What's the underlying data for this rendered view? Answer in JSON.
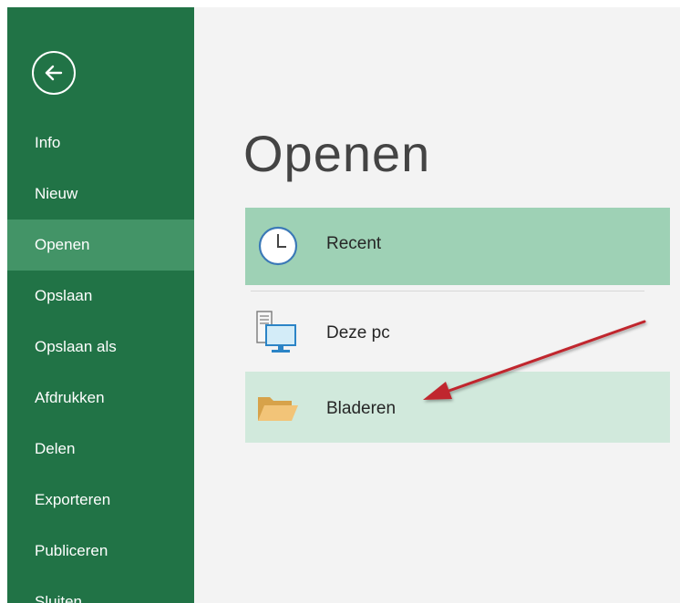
{
  "window": {
    "back_icon": "arrow-left-circle-icon"
  },
  "sidebar": {
    "items": [
      {
        "label": "Info",
        "active": false
      },
      {
        "label": "Nieuw",
        "active": false
      },
      {
        "label": "Openen",
        "active": true
      },
      {
        "label": "Opslaan",
        "active": false
      },
      {
        "label": "Opslaan als",
        "active": false
      },
      {
        "label": "Afdrukken",
        "active": false
      },
      {
        "label": "Delen",
        "active": false
      },
      {
        "label": "Exporteren",
        "active": false
      },
      {
        "label": "Publiceren",
        "active": false
      },
      {
        "label": "Sluiten",
        "active": false
      }
    ]
  },
  "main": {
    "title": "Openen",
    "locations": [
      {
        "label": "Recent",
        "icon": "clock-icon",
        "state": "selected"
      },
      {
        "label": "Deze pc",
        "icon": "computer-icon",
        "state": "normal"
      },
      {
        "label": "Bladeren",
        "icon": "folder-icon",
        "state": "hover"
      }
    ]
  },
  "colors": {
    "sidebar_bg": "#217346",
    "sidebar_active": "#439467",
    "main_bg": "#f3f3f3",
    "selected_bg": "#9ed1b5",
    "hover_bg": "#d1e9dc",
    "annotation_arrow": "#c0282d"
  }
}
